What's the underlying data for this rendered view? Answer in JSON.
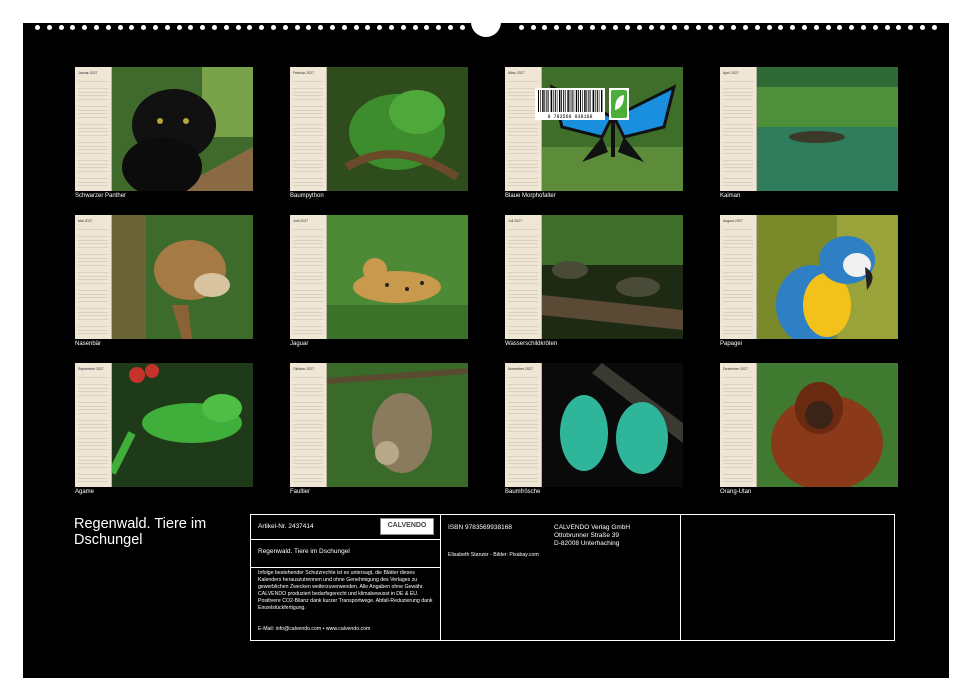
{
  "months": [
    {
      "label": "Januar 2027",
      "caption": "Schwarzer Panther"
    },
    {
      "label": "Februar 2027",
      "caption": "Baumpython"
    },
    {
      "label": "März 2027",
      "caption": "Blaue Morphofalter"
    },
    {
      "label": "April 2027",
      "caption": "Kaiman"
    },
    {
      "label": "Mai 2027",
      "caption": "Nasenbär"
    },
    {
      "label": "Juni 2027",
      "caption": "Jaguar"
    },
    {
      "label": "Juli 2027",
      "caption": "Wasserschildkröten"
    },
    {
      "label": "August 2027",
      "caption": "Papagei"
    },
    {
      "label": "September 2027",
      "caption": "Agame"
    },
    {
      "label": "Oktober 2027",
      "caption": "Faultier"
    },
    {
      "label": "November 2027",
      "caption": "Baumfrösche"
    },
    {
      "label": "Dezember 2027",
      "caption": "Orang-Utan"
    }
  ],
  "title": "Regenwald. Tiere im Dschungel",
  "info": {
    "article": "Artikel-Nr. 2437414",
    "brand": "CALVENDO",
    "subtitle": "Regenwald. Tiere im Dschungel",
    "legal": "Infolge bestehender Schutzrechte ist es untersagt, die Blätter dieses Kalenders herauszutrennen und ohne Genehmigung des Verlages zu gewerblichen Zwecken weiterzuverwenden. Alle Angaben ohne Gewähr. CALVENDO produziert bedarfsgerecht und klimabewusst in DE & EU. Positivere CO2-Bilanz dank kurzer Transportwege. Abfall-Reduzierung dank Einzelstückfertigung.",
    "contact": "E-Mail: info@calvendo.com • www.calvendo.com",
    "isbn": "ISBN 9783569938168",
    "publisher": [
      "CALVENDO Verlag GmbH",
      "Ottobrunner Straße 39",
      "D-82008 Unterhaching"
    ],
    "credits": "Elisabeth Stanzer - Bilder: Pixabay.com",
    "barcode": "9 783569 938168"
  }
}
